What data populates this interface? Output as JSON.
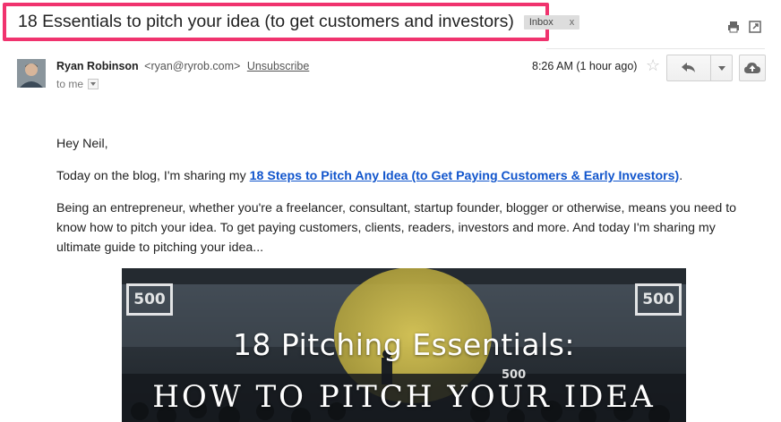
{
  "email": {
    "subject": "18 Essentials to pitch your idea (to get customers and investors)",
    "label": "Inbox",
    "label_remove": "x",
    "sender_name": "Ryan Robinson",
    "sender_email": "<ryan@ryrob.com>",
    "unsubscribe": "Unsubscribe",
    "to": "to me",
    "timestamp": "8:26 AM (1 hour ago)"
  },
  "body": {
    "greeting": "Hey Neil,",
    "intro_prefix": "Today on the blog, I'm sharing my ",
    "link_text": "18 Steps to Pitch Any Idea (to Get Paying Customers & Early Investors)",
    "intro_suffix": ".",
    "paragraph": "Being an entrepreneur, whether you're a freelancer, consultant, startup founder, blogger or otherwise, means you need to know how to pitch your idea. To get paying customers, clients, readers, investors and more. And today I'm sharing my ultimate guide to pitching your idea..."
  },
  "hero": {
    "title": "18 Pitching Essentials:",
    "subtitle": "HOW TO PITCH YOUR IDEA",
    "logo_left": "500",
    "logo_right": "500",
    "logo_small": "500"
  },
  "colors": {
    "highlight_border": "#f0336e",
    "link": "#1155cc",
    "spotlight": "#c9b84a"
  },
  "icons": {
    "print": "print-icon",
    "new_window": "new-window-icon",
    "star": "star-icon",
    "reply": "reply-icon",
    "more": "chevron-down-icon",
    "upload": "cloud-upload-icon"
  }
}
